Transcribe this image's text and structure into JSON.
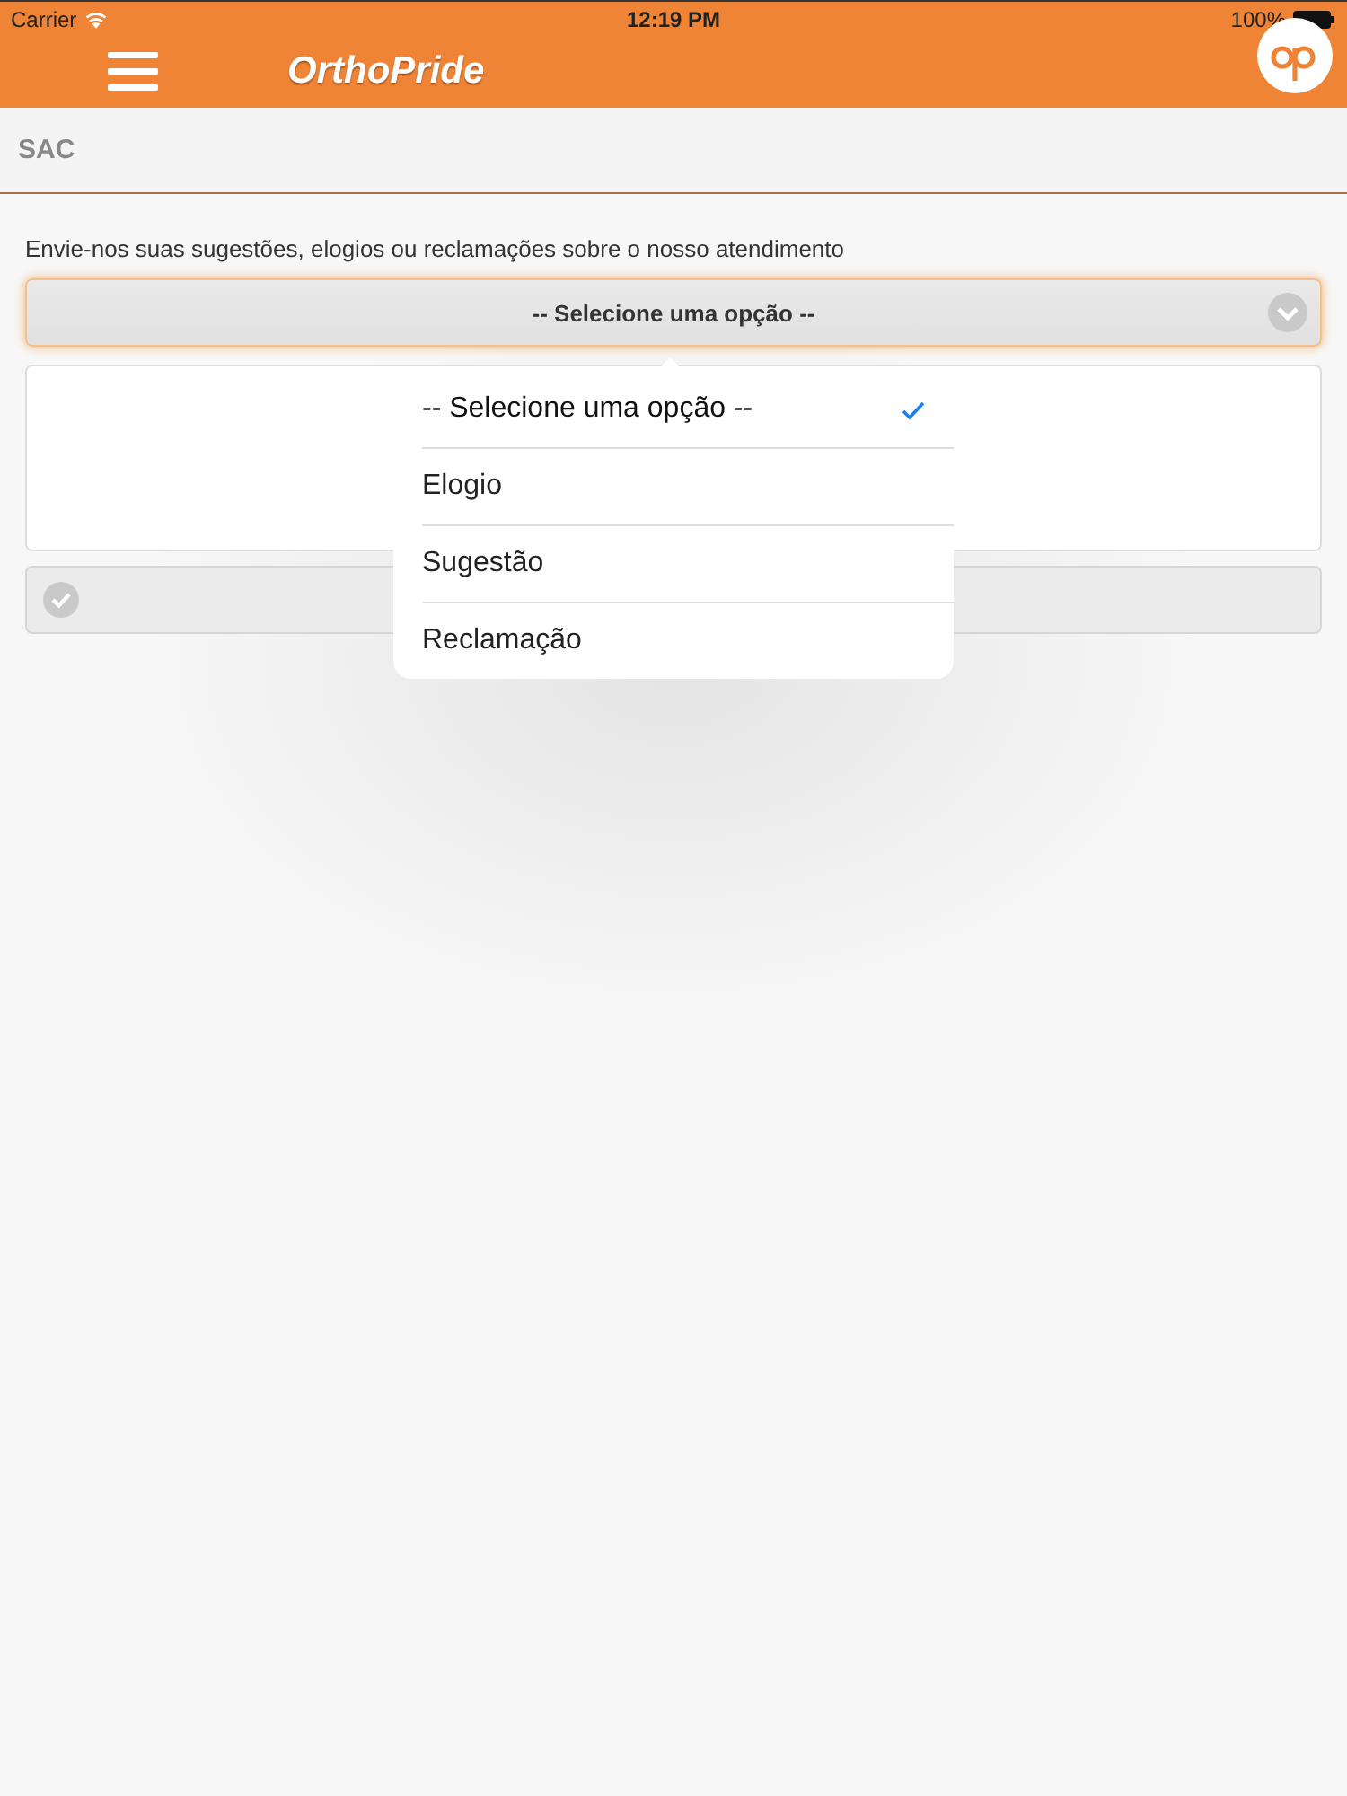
{
  "status_bar": {
    "carrier": "Carrier",
    "time": "12:19 PM",
    "battery": "100%"
  },
  "app_bar": {
    "title": "OrthoPride"
  },
  "page_header": {
    "title": "SAC"
  },
  "form": {
    "instruction": "Envie-nos suas sugestões, elogios ou reclamações sobre o nosso atendimento",
    "select": {
      "value": "-- Selecione uma opção --",
      "expanded": true
    }
  },
  "popover": {
    "options": [
      {
        "label": "-- Selecione uma opção --",
        "selected": true
      },
      {
        "label": "Elogio",
        "selected": false
      },
      {
        "label": "Sugestão",
        "selected": false
      },
      {
        "label": "Reclamação",
        "selected": false
      }
    ]
  }
}
